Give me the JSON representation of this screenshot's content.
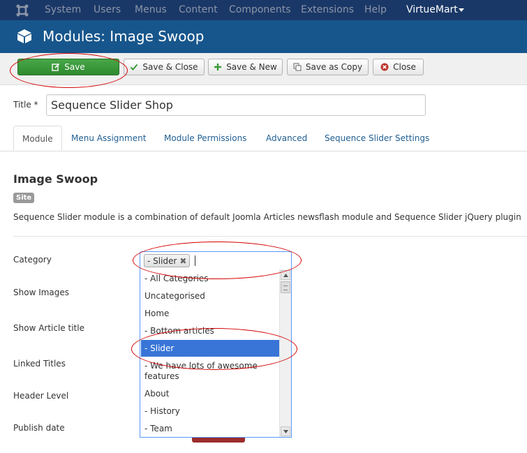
{
  "topnav": {
    "items": [
      "System",
      "Users",
      "Menus",
      "Content",
      "Components",
      "Extensions",
      "Help"
    ],
    "menu_right": "VirtueMart"
  },
  "header": {
    "title": "Modules: Image Swoop"
  },
  "toolbar": {
    "save": "Save",
    "save_close": "Save & Close",
    "save_new": "Save & New",
    "save_copy": "Save as Copy",
    "close": "Close"
  },
  "form": {
    "title_label": "Title *",
    "title_value": "Sequence Slider Shop"
  },
  "tabs": [
    "Module",
    "Menu Assignment",
    "Module Permissions",
    "Advanced",
    "Sequence Slider Settings"
  ],
  "module": {
    "heading": "Image Swoop",
    "badge": "Site",
    "description": "Sequence Slider module is a combination of default Joomla Articles newsflash module and Sequence Slider jQuery plugin"
  },
  "fields": {
    "category": "Category",
    "show_images": "Show Images",
    "show_article_title": "Show Article title",
    "linked_titles": "Linked Titles",
    "header_level": "Header Level",
    "publish_date": "Publish date"
  },
  "category": {
    "selected_chip": "- Slider",
    "options": [
      "- All Categories -",
      "Uncategorised",
      "Home",
      "- Bottom articles",
      "- Slider",
      "- We have lots of awesome",
      "features",
      "About",
      "- History",
      "- Team"
    ],
    "highlighted": "- Slider"
  },
  "colors": {
    "topnav_bg": "#1a3867",
    "header_bg": "#17568c",
    "save_green": "#3c9a3c",
    "highlight_blue": "#3875d7",
    "annotation_red": "#d40000"
  }
}
